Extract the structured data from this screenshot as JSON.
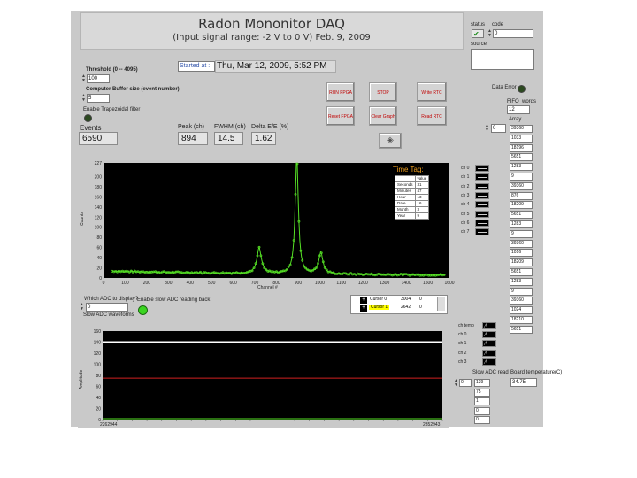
{
  "title": {
    "main": "Radon Mononitor DAQ",
    "subtitle": "(Input signal range: -2 V to 0 V)  Feb. 9, 2009"
  },
  "status_panel": {
    "status_label": "status",
    "code_label": "code",
    "code_value": "0",
    "source_label": "source",
    "check_icon": "check-icon"
  },
  "controls": {
    "threshold_label": "Threshold (0 -- 4095)",
    "threshold_value": "100",
    "buffer_label": "Computer Buffer size (event number)",
    "buffer_value": "5",
    "trapezoidal_label": "Enable Trapezoidal filter",
    "started_label": "Started at :",
    "started_value": "Thu, Mar 12, 2009, 5:52 PM"
  },
  "buttons": {
    "run": "RUN FPGA",
    "stop": "STOP",
    "write_rtc": "Write RTC",
    "reset": "Reset  FPGA",
    "clear": "Clear Graph",
    "read_rtc": "Read RTC"
  },
  "data_error": {
    "label": "Data Error",
    "fifo_label": "FIFO_words",
    "fifo_value": "12",
    "array_label": "Array",
    "array_index": "0"
  },
  "stats": {
    "events_label": "Events",
    "events_value": "6590",
    "peak_label": "Peak (ch)",
    "peak_value": "894",
    "fwhm_label": "FWHM (ch)",
    "fwhm_value": "14.5",
    "delta_label": "Delta E/E (%)",
    "delta_value": "1.62"
  },
  "array_values": [
    "39360",
    "1033",
    "18196",
    "5651",
    "1283",
    "9",
    "39360",
    "876",
    "18209",
    "5651",
    "1283",
    "9",
    "39360",
    "1016",
    "18209",
    "5651",
    "1283",
    "9",
    "39360",
    "1024",
    "18210",
    "5651"
  ],
  "spectrum_legend": [
    "ch 0",
    "ch 1",
    "ch 2",
    "ch 3",
    "ch 4",
    "ch 5",
    "ch 6",
    "ch 7"
  ],
  "time_tag": {
    "title": "Time Tag:",
    "header": "value",
    "rows": [
      {
        "label": "Seconds",
        "value": "31"
      },
      {
        "label": "Minutes",
        "value": "47"
      },
      {
        "label": "Hour",
        "value": "13"
      },
      {
        "label": "Date",
        "value": "16"
      },
      {
        "label": "Month",
        "value": "3"
      },
      {
        "label": "Year",
        "value": "9"
      }
    ]
  },
  "slow_adc": {
    "which_label": "Which ADC to display?",
    "which_value": "0",
    "waveform_label": "Slow ADC waveforms",
    "enable_label": "Enable slow ADC reading back",
    "cursor0_label": "Cursor 0",
    "cursor0_x": "3004",
    "cursor0_y": "0",
    "cursor1_label": "Cursor 1",
    "cursor1_x": "2642",
    "cursor1_y": "0",
    "legend": [
      "ch temp",
      "ch 0",
      "ch 1",
      "ch 2",
      "ch 3"
    ],
    "read_label": "Slow ADC read",
    "read_index": "0",
    "read_values": [
      "139",
      "75",
      "1",
      "0",
      "0"
    ],
    "board_temp_label": "Board temperature(C)",
    "board_temp_value": "34.75",
    "x_start": "2262944",
    "x_end": "2352943"
  },
  "spectrum_chart": {
    "type": "line",
    "xlabel": "Channel #",
    "ylabel": "Counts",
    "xlim": [
      0,
      1600
    ],
    "ylim": [
      0,
      227
    ],
    "xticks": [
      0,
      100,
      200,
      300,
      400,
      500,
      600,
      700,
      800,
      900,
      1000,
      1100,
      1200,
      1300,
      1400,
      1500,
      1600
    ],
    "yticks": [
      0,
      20,
      40,
      60,
      80,
      100,
      120,
      140,
      160,
      180,
      200,
      227
    ],
    "color": "#55e025",
    "peaks": [
      {
        "center": 720,
        "height": 50,
        "width": 12
      },
      {
        "center": 894,
        "height": 227,
        "width": 9
      },
      {
        "center": 1005,
        "height": 42,
        "width": 12
      }
    ],
    "baseline": 9
  },
  "slow_chart": {
    "type": "line",
    "ylabel": "Amplitude",
    "ylim": [
      0,
      160
    ],
    "yticks": [
      0,
      20,
      40,
      60,
      80,
      100,
      120,
      140,
      160
    ],
    "white_level": 140,
    "red_level": 75,
    "xticks": [
      0,
      100,
      200,
      300,
      400,
      500,
      600,
      700,
      800,
      900,
      1000,
      1100,
      1200,
      1300,
      1400,
      1500,
      1600,
      1700,
      1800,
      1900,
      2000,
      2100,
      2200,
      2300
    ]
  },
  "colors": {
    "panel": "#c9c9c9",
    "plot_bg": "#000000",
    "trace": "#55e025",
    "led_green": "#2a9a1a",
    "button_text": "#c00000"
  }
}
